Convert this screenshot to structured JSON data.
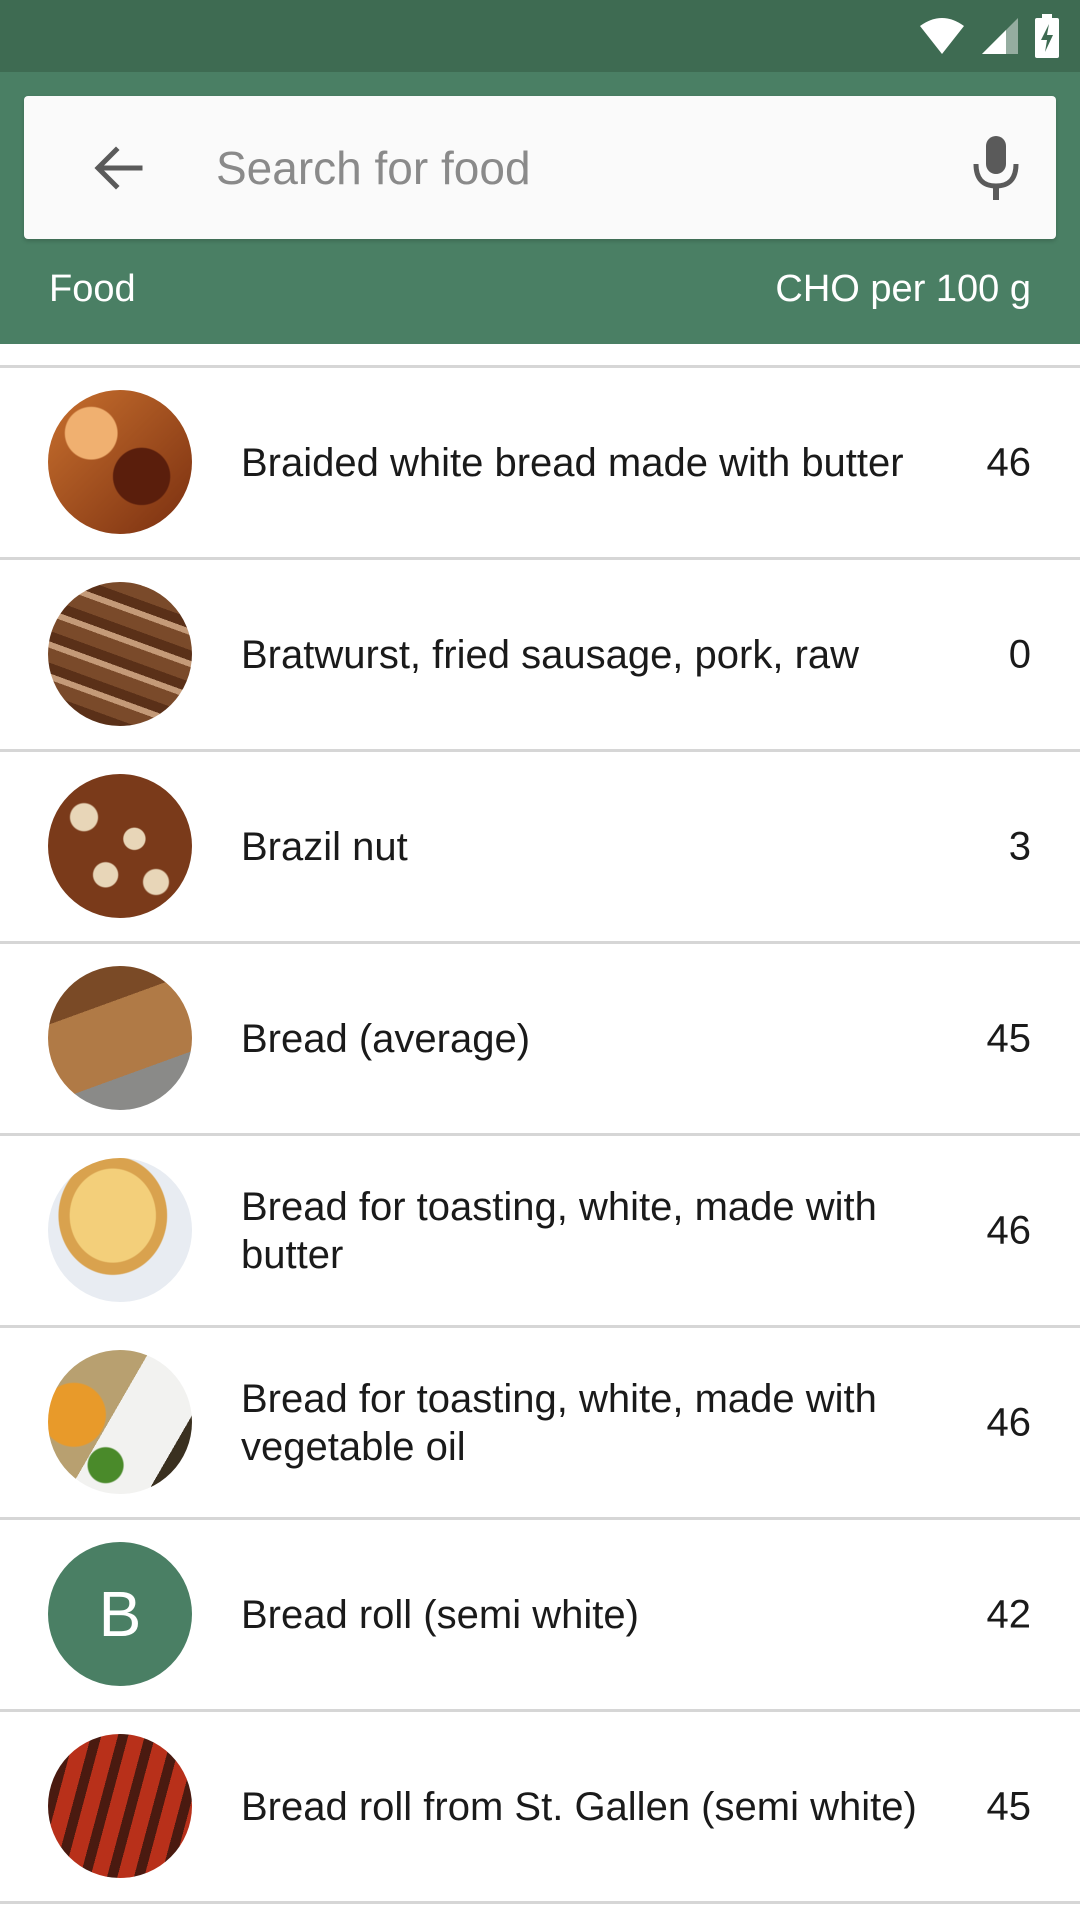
{
  "search": {
    "placeholder": "Search for food"
  },
  "columns": {
    "food": "Food",
    "cho": "CHO per 100 g"
  },
  "colors": {
    "status_bar": "#3e6b52",
    "app_bar": "#4a7f64",
    "accent": "#4a7f64"
  },
  "items": [
    {
      "name": "Braided white bread made with butter",
      "value": "46",
      "thumb": "photo-braided-bread"
    },
    {
      "name": "Bratwurst, fried sausage, pork, raw",
      "value": "0",
      "thumb": "photo-bratwurst"
    },
    {
      "name": "Brazil nut",
      "value": "3",
      "thumb": "photo-brazil-nuts"
    },
    {
      "name": "Bread (average)",
      "value": "45",
      "thumb": "photo-bread-loaf"
    },
    {
      "name": "Bread for toasting, white, made with butter",
      "value": "46",
      "thumb": "photo-toast"
    },
    {
      "name": "Bread for toasting, white, made with vegetable oil",
      "value": "46",
      "thumb": "photo-bread-plate"
    },
    {
      "name": "Bread roll (semi white)",
      "value": "42",
      "thumb": "letter-avatar",
      "letter": "B"
    },
    {
      "name": "Bread roll from St. Gallen (semi white)",
      "value": "45",
      "thumb": "photo-grilled-sausages"
    }
  ]
}
